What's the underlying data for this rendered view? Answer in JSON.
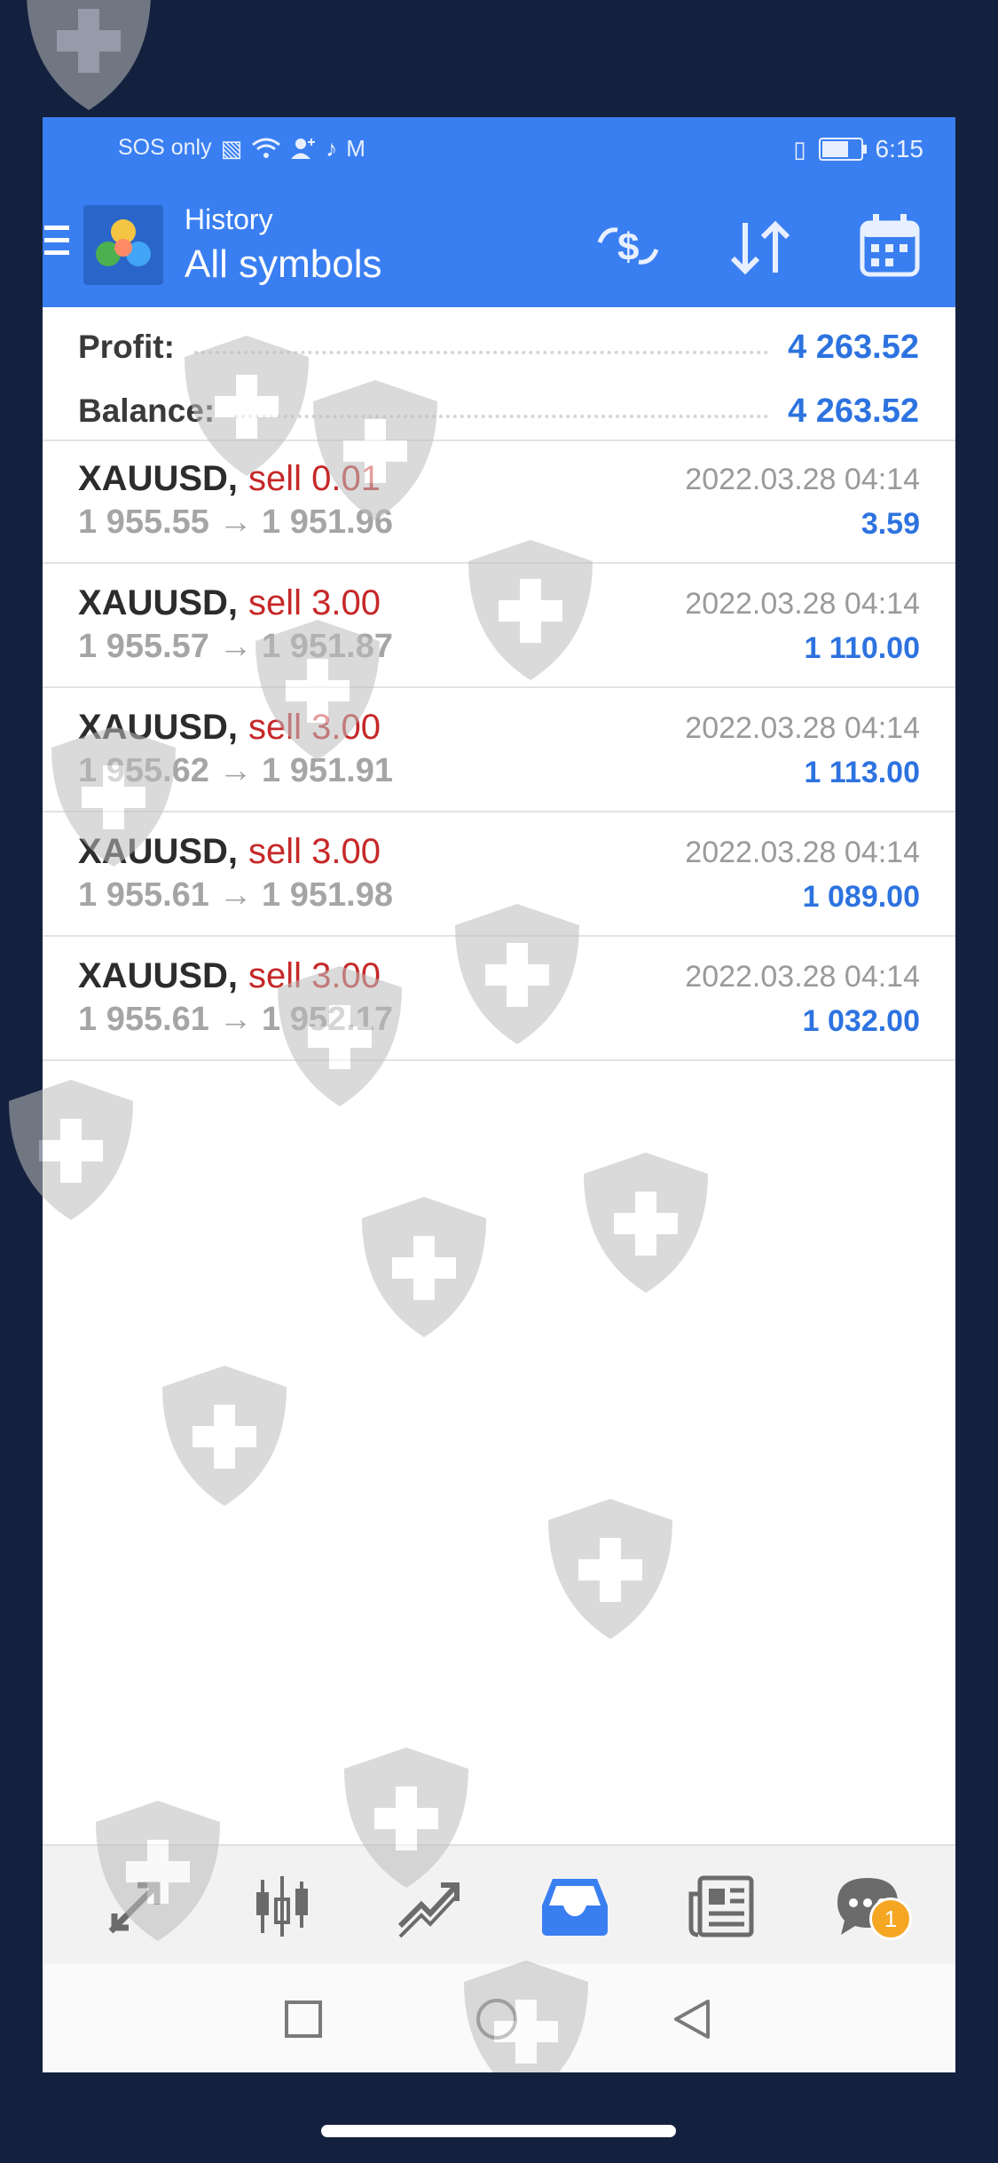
{
  "status_bar": {
    "carrier": "SOS only",
    "time": "6:15",
    "battery_level": 0.7
  },
  "app_bar": {
    "subtitle": "History",
    "title": "All symbols"
  },
  "summary": {
    "profit_label": "Profit:",
    "profit_value": "4 263.52",
    "balance_label": "Balance:",
    "balance_value": "4 263.52"
  },
  "deals": [
    {
      "symbol": "XAUUSD,",
      "type": "sell 0.01",
      "open": "1 955.55",
      "arrow": "→",
      "close": "1 951.96",
      "time": "2022.03.28 04:14",
      "profit": "3.59"
    },
    {
      "symbol": "XAUUSD,",
      "type": "sell 3.00",
      "open": "1 955.57",
      "arrow": "→",
      "close": "1 951.87",
      "time": "2022.03.28 04:14",
      "profit": "1 110.00"
    },
    {
      "symbol": "XAUUSD,",
      "type": "sell 3.00",
      "open": "1 955.62",
      "arrow": "→",
      "close": "1 951.91",
      "time": "2022.03.28 04:14",
      "profit": "1 113.00"
    },
    {
      "symbol": "XAUUSD,",
      "type": "sell 3.00",
      "open": "1 955.61",
      "arrow": "→",
      "close": "1 951.98",
      "time": "2022.03.28 04:14",
      "profit": "1 089.00"
    },
    {
      "symbol": "XAUUSD,",
      "type": "sell 3.00",
      "open": "1 955.61",
      "arrow": "→",
      "close": "1 952.17",
      "time": "2022.03.28 04:14",
      "profit": "1 032.00"
    }
  ],
  "tab_bar": {
    "chat_badge": "1",
    "active_tab": "history"
  },
  "colors": {
    "accent": "#3a7ff1",
    "profit": "#2d73e0",
    "sell": "#c62828",
    "background": "#14213e"
  }
}
